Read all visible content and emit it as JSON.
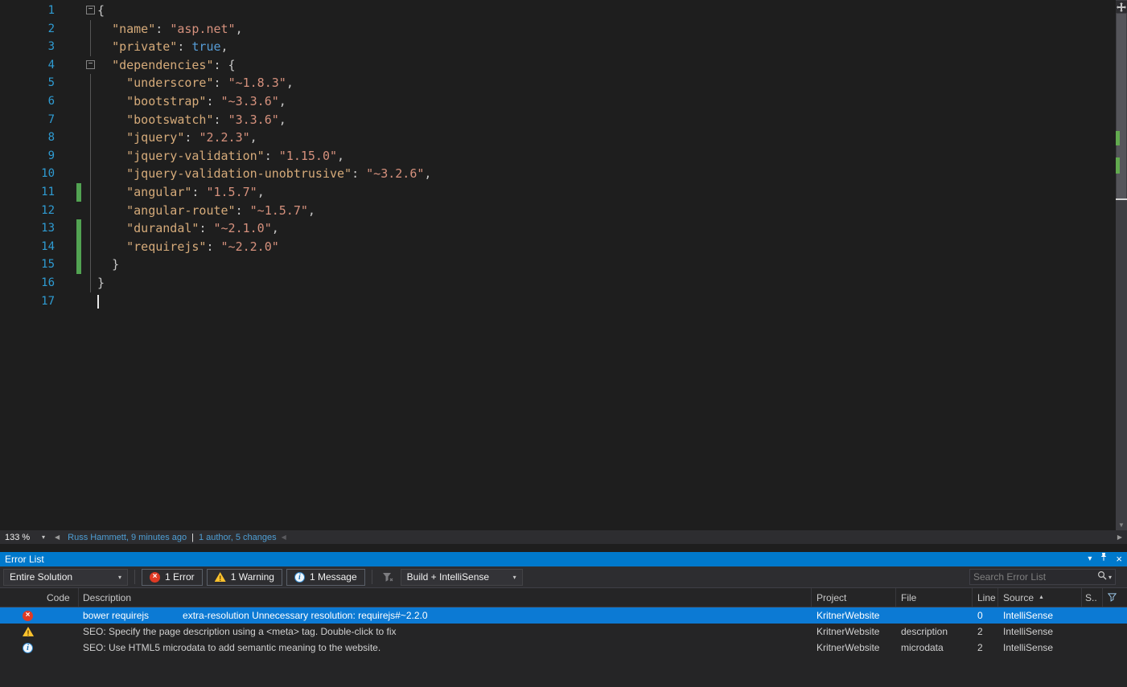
{
  "icons": {
    "chevron_down": "▾",
    "scroll_left": "◀",
    "scroll_right": "▶",
    "scroll_down": "▼",
    "close": "×",
    "sort_asc": "▲",
    "fold_collapse": "−",
    "separator": "|"
  },
  "editor": {
    "zoom_level": "133 %",
    "annotation": {
      "author_line": "Russ Hammett, 9 minutes ago",
      "changes_line": "1 author, 5 changes"
    },
    "lines": [
      {
        "n": "1",
        "fold": true,
        "toks": [
          [
            "p",
            "{"
          ]
        ]
      },
      {
        "n": "2",
        "guide": true,
        "toks": [
          [
            "w",
            "  "
          ],
          [
            "k",
            "\"name\""
          ],
          [
            "p",
            ": "
          ],
          [
            "s",
            "\"asp.net\""
          ],
          [
            "p",
            ","
          ]
        ]
      },
      {
        "n": "3",
        "guide": true,
        "toks": [
          [
            "w",
            "  "
          ],
          [
            "k",
            "\"private\""
          ],
          [
            "p",
            ": "
          ],
          [
            "b",
            "true"
          ],
          [
            "p",
            ","
          ]
        ]
      },
      {
        "n": "4",
        "fold": true,
        "toks": [
          [
            "w",
            "  "
          ],
          [
            "k",
            "\"dependencies\""
          ],
          [
            "p",
            ": {"
          ]
        ]
      },
      {
        "n": "5",
        "guide": true,
        "toks": [
          [
            "w",
            "    "
          ],
          [
            "k",
            "\"underscore\""
          ],
          [
            "p",
            ": "
          ],
          [
            "s",
            "\"~1.8.3\""
          ],
          [
            "p",
            ","
          ]
        ]
      },
      {
        "n": "6",
        "guide": true,
        "toks": [
          [
            "w",
            "    "
          ],
          [
            "k",
            "\"bootstrap\""
          ],
          [
            "p",
            ": "
          ],
          [
            "s",
            "\"~3.3.6\""
          ],
          [
            "p",
            ","
          ]
        ]
      },
      {
        "n": "7",
        "guide": true,
        "toks": [
          [
            "w",
            "    "
          ],
          [
            "k",
            "\"bootswatch\""
          ],
          [
            "p",
            ": "
          ],
          [
            "s",
            "\"3.3.6\""
          ],
          [
            "p",
            ","
          ]
        ]
      },
      {
        "n": "8",
        "guide": true,
        "toks": [
          [
            "w",
            "    "
          ],
          [
            "k",
            "\"jquery\""
          ],
          [
            "p",
            ": "
          ],
          [
            "s",
            "\"2.2.3\""
          ],
          [
            "p",
            ","
          ]
        ]
      },
      {
        "n": "9",
        "guide": true,
        "toks": [
          [
            "w",
            "    "
          ],
          [
            "k",
            "\"jquery-validation\""
          ],
          [
            "p",
            ": "
          ],
          [
            "s",
            "\"1.15.0\""
          ],
          [
            "p",
            ","
          ]
        ]
      },
      {
        "n": "10",
        "guide": true,
        "toks": [
          [
            "w",
            "    "
          ],
          [
            "k",
            "\"jquery-validation-unobtrusive\""
          ],
          [
            "p",
            ": "
          ],
          [
            "s",
            "\"~3.2.6\""
          ],
          [
            "p",
            ","
          ]
        ]
      },
      {
        "n": "11",
        "guide": true,
        "changed": true,
        "toks": [
          [
            "w",
            "    "
          ],
          [
            "k",
            "\"angular\""
          ],
          [
            "p",
            ": "
          ],
          [
            "s",
            "\"1.5.7\""
          ],
          [
            "p",
            ","
          ]
        ]
      },
      {
        "n": "12",
        "guide": true,
        "toks": [
          [
            "w",
            "    "
          ],
          [
            "k",
            "\"angular-route\""
          ],
          [
            "p",
            ": "
          ],
          [
            "s",
            "\"~1.5.7\""
          ],
          [
            "p",
            ","
          ]
        ]
      },
      {
        "n": "13",
        "guide": true,
        "changed": true,
        "toks": [
          [
            "w",
            "    "
          ],
          [
            "k",
            "\"durandal\""
          ],
          [
            "p",
            ": "
          ],
          [
            "s",
            "\"~2.1.0\""
          ],
          [
            "p",
            ","
          ]
        ]
      },
      {
        "n": "14",
        "guide": true,
        "changed": true,
        "toks": [
          [
            "w",
            "    "
          ],
          [
            "k",
            "\"requirejs\""
          ],
          [
            "p",
            ": "
          ],
          [
            "s",
            "\"~2.2.0\""
          ]
        ]
      },
      {
        "n": "15",
        "guide": true,
        "changed": true,
        "toks": [
          [
            "w",
            "  "
          ],
          [
            "p",
            "}"
          ]
        ]
      },
      {
        "n": "16",
        "guide": true,
        "toks": [
          [
            "p",
            "}"
          ]
        ]
      },
      {
        "n": "17",
        "caret": true,
        "toks": []
      }
    ]
  },
  "error_list": {
    "title": "Error List",
    "toolbar": {
      "scope": "Entire Solution",
      "error_count": "1 Error",
      "warning_count": "1 Warning",
      "message_count": "1 Message",
      "build_filter": "Build + IntelliSense",
      "search_placeholder": "Search Error List"
    },
    "columns": {
      "code": "Code",
      "description": "Description",
      "project": "Project",
      "file": "File",
      "line": "Line",
      "source": "Source",
      "severity_short": "S.."
    },
    "rows": [
      {
        "severity": "error",
        "selected": true,
        "code": "bower requirejs",
        "description": "extra-resolution Unnecessary resolution: requirejs#~2.2.0",
        "project": "KritnerWebsite",
        "file": "",
        "line": "0",
        "source": "IntelliSense"
      },
      {
        "severity": "warning",
        "selected": false,
        "code": "",
        "description": "SEO: Specify the page description using a <meta> tag. Double-click to fix",
        "project": "KritnerWebsite",
        "file": "description",
        "line": "2",
        "source": "IntelliSense"
      },
      {
        "severity": "message",
        "selected": false,
        "code": "",
        "description": "SEO: Use HTML5 microdata to add semantic meaning to the website.",
        "project": "KritnerWebsite",
        "file": "microdata",
        "line": "2",
        "source": "IntelliSense"
      }
    ]
  }
}
